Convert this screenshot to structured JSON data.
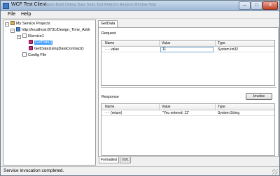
{
  "window": {
    "title": "WCF Test Client",
    "background_menu": "Project   Build   Debug   Data   Tools   Test   Refactor   Analyze   Window   Help",
    "minimize": "–",
    "maximize": "□",
    "close": "✕"
  },
  "menu": {
    "file": "File",
    "help": "Help"
  },
  "tree": {
    "root": "My Service Projects",
    "endpoint": "http://localhost:8731/Design_Time_Addr",
    "contract": "IService1",
    "operations": [
      "GetData()",
      "GetDataUsingDataContract()"
    ],
    "config": "Config File"
  },
  "tab": {
    "title": "GetData"
  },
  "request": {
    "label": "Request",
    "columns": [
      "Name",
      "Value",
      "Type"
    ],
    "rows": [
      {
        "name": "value",
        "value": "11",
        "type": "System.Int32"
      }
    ]
  },
  "response": {
    "label": "Response",
    "invoke_label": "Invoke",
    "columns": [
      "Name",
      "Value",
      "Type"
    ],
    "rows": [
      {
        "name": "(return)",
        "value": "\"You entered: 11\"",
        "type": "System.String"
      }
    ]
  },
  "bottom_tabs": [
    "Formatted",
    "XML"
  ],
  "status": {
    "text": "Service invocation completed."
  },
  "colors": {
    "selection": "#3399ff",
    "titlebar": "#b4c9e2"
  }
}
